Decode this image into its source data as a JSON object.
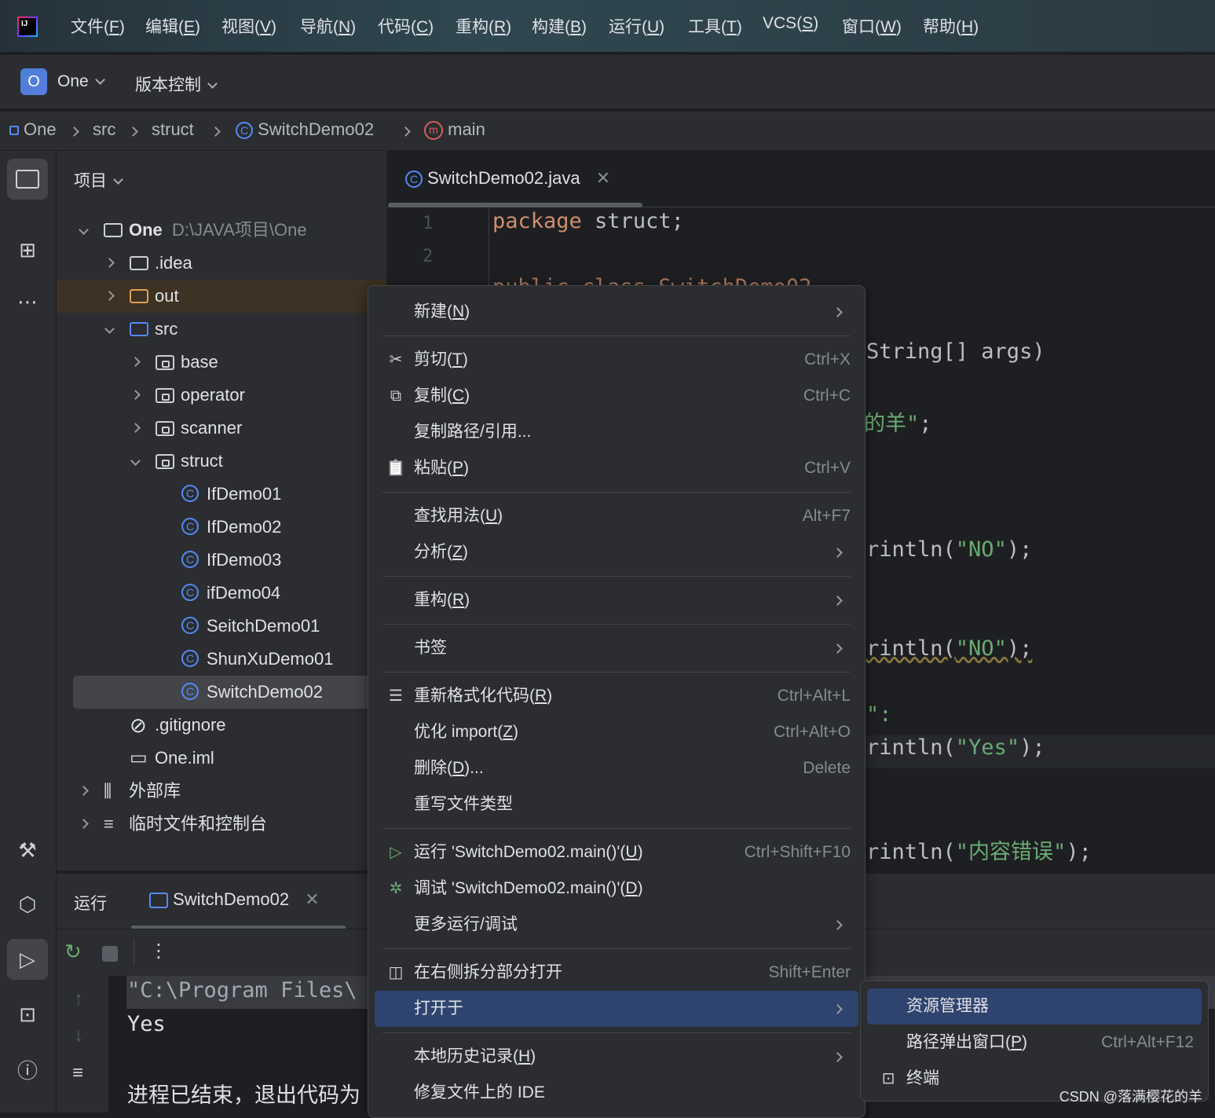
{
  "menubar": [
    {
      "label": "文件",
      "mn": "F"
    },
    {
      "label": "编辑",
      "mn": "E"
    },
    {
      "label": "视图",
      "mn": "V"
    },
    {
      "label": "导航",
      "mn": "N"
    },
    {
      "label": "代码",
      "mn": "C"
    },
    {
      "label": "重构",
      "mn": "R"
    },
    {
      "label": "构建",
      "mn": "B"
    },
    {
      "label": "运行",
      "mn": "U"
    },
    {
      "label": "工具",
      "mn": "T"
    },
    {
      "label": "VCS",
      "mn": "S"
    },
    {
      "label": "窗口",
      "mn": "W"
    },
    {
      "label": "帮助",
      "mn": "H"
    }
  ],
  "toolbar": {
    "project_badge": "O",
    "project_name": "One",
    "vcs": "版本控制"
  },
  "breadcrumb": [
    "One",
    "src",
    "struct",
    "SwitchDemo02",
    "main"
  ],
  "project": {
    "title": "项目",
    "tree": [
      {
        "label": "One",
        "path": "D:\\JAVA项目\\One",
        "type": "module",
        "level": 0,
        "expanded": true
      },
      {
        "label": ".idea",
        "type": "folder",
        "level": 1,
        "expanded": false
      },
      {
        "label": "out",
        "type": "folder-excluded",
        "level": 1,
        "expanded": false
      },
      {
        "label": "src",
        "type": "folder-src",
        "level": 1,
        "expanded": true
      },
      {
        "label": "base",
        "type": "package",
        "level": 2,
        "expanded": false
      },
      {
        "label": "operator",
        "type": "package",
        "level": 2,
        "expanded": false
      },
      {
        "label": "scanner",
        "type": "package",
        "level": 2,
        "expanded": false
      },
      {
        "label": "struct",
        "type": "package",
        "level": 2,
        "expanded": true
      },
      {
        "label": "IfDemo01",
        "type": "class",
        "level": 3
      },
      {
        "label": "IfDemo02",
        "type": "class",
        "level": 3
      },
      {
        "label": "IfDemo03",
        "type": "class",
        "level": 3
      },
      {
        "label": "ifDemo04",
        "type": "class",
        "level": 3
      },
      {
        "label": "SeitchDemo01",
        "type": "class",
        "level": 3
      },
      {
        "label": "ShunXuDemo01",
        "type": "class",
        "level": 3
      },
      {
        "label": "SwitchDemo02",
        "type": "class",
        "level": 3,
        "selected": true
      },
      {
        "label": ".gitignore",
        "type": "ignore",
        "level": 1
      },
      {
        "label": "One.iml",
        "type": "iml",
        "level": 1
      },
      {
        "label": "外部库",
        "type": "library",
        "level": 0,
        "expanded": false
      },
      {
        "label": "临时文件和控制台",
        "type": "scratch",
        "level": 0,
        "expanded": false
      }
    ]
  },
  "editor": {
    "tab": "SwitchDemo02.java",
    "line_numbers": [
      "1",
      "2"
    ],
    "code": {
      "l1_kw": "package",
      "l1_rest": " struct;",
      "l3_partial": "public class SwitchDemo02",
      "l5": "String[] args)",
      "l7_str": "的羊\"",
      "l7_end": ";",
      "l11_a": "rintln(",
      "l11_s": "\"NO\"",
      "l11_b": ");",
      "l14_a": "rintln(",
      "l14_s": "\"NO\"",
      "l14_b": ");",
      "l16": "\":",
      "l17_a": "rintln(",
      "l17_s": "\"Yes\"",
      "l17_b": ");",
      "l20_a": "rintln(",
      "l20_s": "\"内容错误\"",
      "l20_b": ");"
    }
  },
  "run": {
    "label": "运行",
    "tab": "SwitchDemo02",
    "console": [
      "\"C:\\Program Files\\",
      "Yes",
      "",
      "进程已结束，退出代码为"
    ]
  },
  "context_menu": [
    {
      "label": "新建",
      "mn": "N",
      "submenu": true
    },
    {
      "sep": true
    },
    {
      "label": "剪切",
      "mn": "T",
      "shortcut": "Ctrl+X",
      "icon": "scissors-icon"
    },
    {
      "label": "复制",
      "mn": "C",
      "shortcut": "Ctrl+C",
      "icon": "copy-icon"
    },
    {
      "label": "复制路径/引用..."
    },
    {
      "label": "粘贴",
      "mn": "P",
      "shortcut": "Ctrl+V",
      "icon": "paste-icon"
    },
    {
      "sep": true
    },
    {
      "label": "查找用法",
      "mn": "U",
      "shortcut": "Alt+F7"
    },
    {
      "label": "分析",
      "mn": "Z",
      "submenu": true
    },
    {
      "sep": true
    },
    {
      "label": "重构",
      "mn": "R",
      "submenu": true
    },
    {
      "sep": true
    },
    {
      "label": "书签",
      "submenu": true
    },
    {
      "sep": true
    },
    {
      "label": "重新格式化代码",
      "mn": "R",
      "shortcut": "Ctrl+Alt+L",
      "icon": "reformat-icon"
    },
    {
      "label": "优化 import",
      "mn": "Z",
      "shortcut": "Ctrl+Alt+O"
    },
    {
      "label": "删除",
      "mn": "D",
      "suffix": "...",
      "shortcut": "Delete"
    },
    {
      "label": "重写文件类型"
    },
    {
      "sep": true
    },
    {
      "label": "运行 'SwitchDemo02.main()'",
      "mn": "U",
      "shortcut": "Ctrl+Shift+F10",
      "icon": "run-icon"
    },
    {
      "label": "调试 'SwitchDemo02.main()'",
      "mn": "D",
      "icon": "debug-icon"
    },
    {
      "label": "更多运行/调试",
      "submenu": true
    },
    {
      "sep": true
    },
    {
      "label": "在右侧拆分部分打开",
      "shortcut": "Shift+Enter",
      "icon": "split-icon"
    },
    {
      "label": "打开于",
      "submenu": true,
      "selected": true
    },
    {
      "sep": true
    },
    {
      "label": "本地历史记录",
      "mn": "H",
      "submenu": true
    },
    {
      "label": "修复文件上的 IDE"
    }
  ],
  "submenu": [
    {
      "label": "资源管理器",
      "selected": true
    },
    {
      "label": "路径弹出窗口",
      "mn": "P",
      "shortcut": "Ctrl+Alt+F12"
    },
    {
      "label": "终端",
      "icon": "terminal-icon"
    }
  ],
  "watermark": "CSDN @落满樱花的羊",
  "colors": {
    "accent": "#548af7",
    "selection": "#2e436e",
    "keyword": "#cf8e6d",
    "string": "#6aab73",
    "excluded_folder": "#e0a056"
  }
}
